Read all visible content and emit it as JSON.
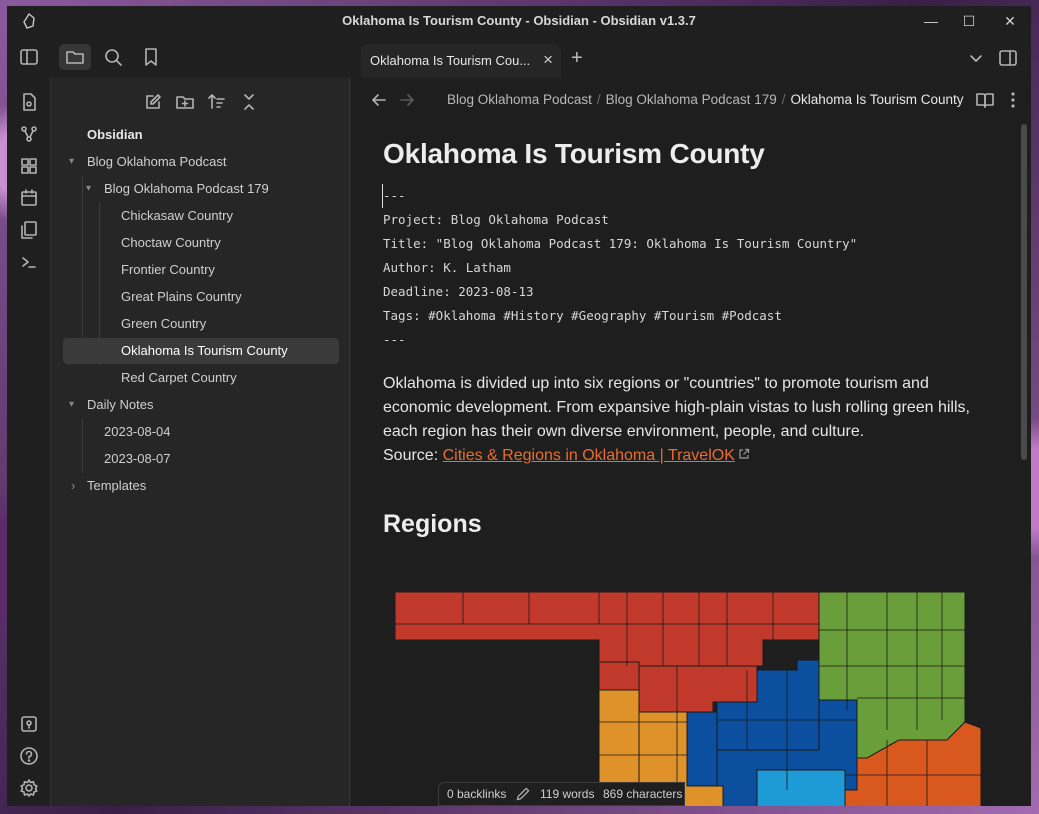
{
  "window": {
    "title": "Oklahoma Is Tourism County - Obsidian - Obsidian v1.3.7",
    "controls": {
      "minimize": "—",
      "maximize": "☐",
      "close": "✕"
    }
  },
  "tab": {
    "label": "Oklahoma Is Tourism Cou...",
    "close": "×",
    "new_tab": "+"
  },
  "explorer": {
    "vault_name": "Obsidian",
    "tree": [
      {
        "label": "Blog Oklahoma Podcast",
        "chevron": "▾"
      },
      {
        "label": "Blog Oklahoma Podcast 179",
        "chevron": "▾"
      },
      {
        "label": "Chickasaw Country"
      },
      {
        "label": "Choctaw Country"
      },
      {
        "label": "Frontier Country"
      },
      {
        "label": "Great Plains Country"
      },
      {
        "label": "Green Country"
      },
      {
        "label": "Oklahoma Is Tourism County",
        "active": true
      },
      {
        "label": "Red Carpet Country"
      },
      {
        "label": "Daily Notes",
        "chevron": "▾"
      },
      {
        "label": "2023-08-04"
      },
      {
        "label": "2023-08-07"
      },
      {
        "label": "Templates",
        "chevron": "›"
      }
    ]
  },
  "breadcrumb": {
    "items": [
      "Blog Oklahoma Podcast",
      "Blog Oklahoma Podcast 179",
      "Oklahoma Is Tourism County"
    ],
    "separator": "/"
  },
  "note": {
    "title": "Oklahoma Is Tourism County",
    "frontmatter": {
      "open": "---",
      "project": "Project: Blog Oklahoma Podcast",
      "title": "Title: \"Blog Oklahoma Podcast 179: Oklahoma Is Tourism Country\"",
      "author": "Author: K. Latham",
      "deadline": "Deadline: 2023-08-13",
      "tags": "Tags: #Oklahoma #History #Geography #Tourism #Podcast",
      "close": "---"
    },
    "body": "Oklahoma is divided up into six regions or \"countries\" to promote tourism and economic development. From expansive high-plain vistas to lush rolling green hills, each region has their own diverse environment, people, and culture.",
    "source_label": "Source:",
    "source_link": "Cities & Regions in Oklahoma | TravelOK",
    "section_heading": "Regions"
  },
  "map_colors": {
    "great_plains": "#c0392b",
    "green": "#6a9e3a",
    "frontier": "#0b4f9e",
    "chickasaw": "#1e9ad6",
    "choctaw": "#d9581e",
    "red_carpet_alt": "#e0922a"
  },
  "status": {
    "backlinks": "0 backlinks",
    "words": "119 words",
    "characters": "869 characters"
  },
  "icons": {
    "ribbon_top": [
      "open-quick-switcher-icon",
      "graph-view-icon",
      "canvas-icon",
      "daily-note-icon",
      "templates-icon",
      "command-palette-icon"
    ],
    "ribbon_bottom": [
      "vault-switcher-icon",
      "help-icon",
      "settings-icon"
    ]
  }
}
